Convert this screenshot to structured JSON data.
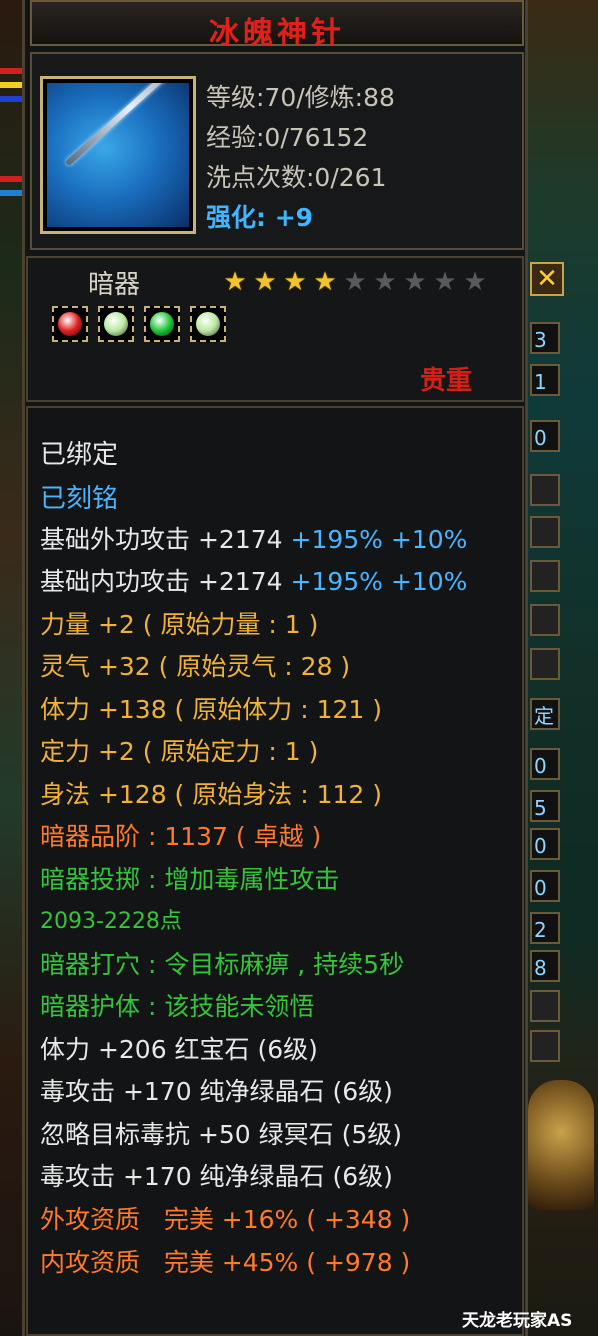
{
  "title": "冰魄神针",
  "stats": {
    "level": "等级:70/修炼:88",
    "exp": "经验:0/76152",
    "reset": "洗点次数:0/261",
    "enhance_label": "强化:",
    "enhance_value": "+9"
  },
  "type_label": "暗器",
  "stars": {
    "filled": 4,
    "total": 9
  },
  "gems": [
    {
      "icon": "red-gem-icon",
      "color": "#e02020"
    },
    {
      "icon": "pale-green-gem-icon",
      "color": "#b8e8a0"
    },
    {
      "icon": "green-gem-icon",
      "color": "#1ec83a"
    },
    {
      "icon": "pale-green-gem-icon",
      "color": "#b8e8a0"
    }
  ],
  "rank": "贵重",
  "lines": {
    "bound": "已绑定",
    "engraved": "已刻铭",
    "outer_label": "基础外功攻击",
    "outer_val": "+2174",
    "outer_pct": "+195%",
    "outer_bonus": "+10%",
    "inner_label": "基础内功攻击",
    "inner_val": "+2174",
    "inner_pct": "+195%",
    "inner_bonus": "+10%",
    "str": "力量 +2 ( 原始力量 : 1 )",
    "spirit": "灵气 +32 ( 原始灵气 : 28 )",
    "vit": "体力 +138 ( 原始体力 : 121 )",
    "focus": "定力 +2 ( 原始定力 : 1 )",
    "agi": "身法 +128 ( 原始身法 : 112 )",
    "grade": "暗器品阶 : 1137 ( 卓越 )",
    "throw": "暗器投掷 : 增加毒属性攻击",
    "throw_range": "2093-2228点",
    "point": "暗器打穴 : 令目标麻痹 , 持续5秒",
    "guard": "暗器护体 : 该技能未领悟",
    "gem1": "体力 +206 红宝石 (6级)",
    "gem2": "毒攻击 +170 纯净绿晶石 (6级)",
    "gem3": "忽略目标毒抗 +50 绿冥石 (5级)",
    "gem4": "毒攻击 +170 纯净绿晶石 (6级)",
    "q1": "外攻资质   完美 +16% ( +348 )",
    "q2": "内攻资质   完美 +45% ( +978 )"
  },
  "right_tabs": [
    "3",
    "1",
    "0",
    "",
    "",
    "",
    "",
    "",
    "定",
    "0",
    "5",
    "0",
    "0",
    "2",
    "8",
    "",
    ""
  ],
  "watermark": "天龙老玩家AS"
}
